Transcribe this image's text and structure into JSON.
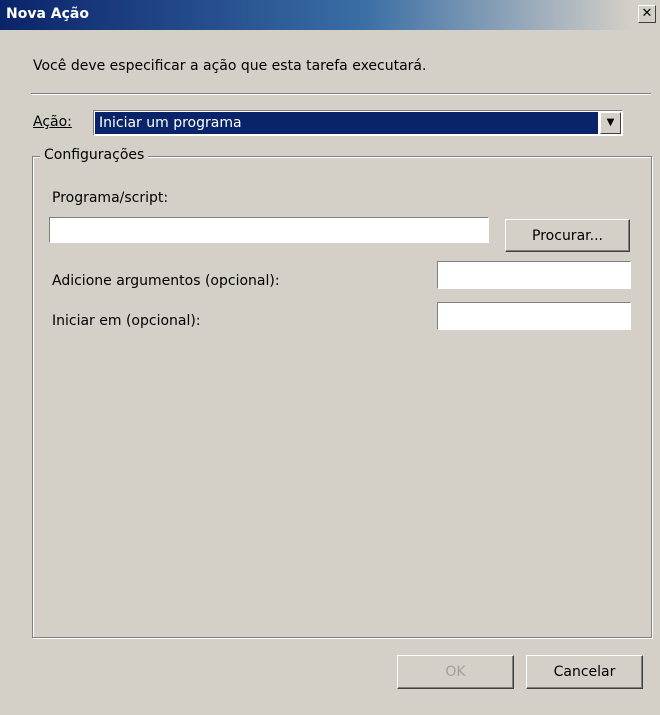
{
  "window": {
    "title": "Nova Ação",
    "close_glyph": "✕"
  },
  "instruction": "Você deve especificar a ação que esta tarefa executará.",
  "action": {
    "label": "Ação:",
    "selected_value": "Iniciar um programa",
    "dropdown_glyph": "▼"
  },
  "settings": {
    "group_label": "Configurações",
    "program_label": "Programa/script:",
    "program_value": "",
    "browse_button": "Procurar...",
    "arguments_label": "Adicione argumentos (opcional):",
    "arguments_value": "",
    "start_in_label": "Iniciar em (opcional):",
    "start_in_value": ""
  },
  "footer": {
    "ok_button": "OK",
    "cancel_button": "Cancelar"
  }
}
